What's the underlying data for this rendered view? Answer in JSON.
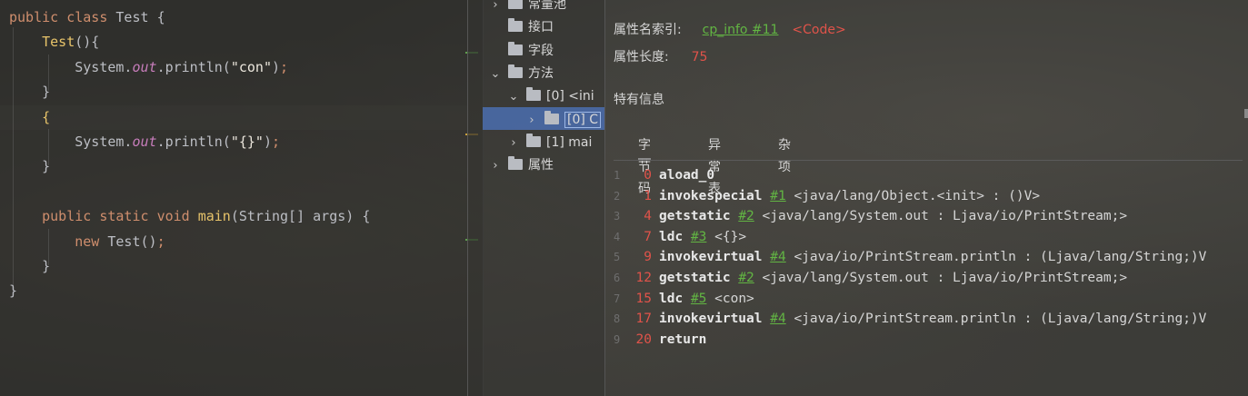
{
  "editor": {
    "lines": [
      [
        [
          "kw",
          "public "
        ],
        [
          "kw",
          "class "
        ],
        [
          "cls",
          "Test "
        ],
        [
          "punc",
          "{"
        ]
      ],
      [
        [
          "punc",
          "    "
        ],
        [
          "fn",
          "Test"
        ],
        [
          "punc",
          "(){"
        ]
      ],
      [
        [
          "punc",
          "        System."
        ],
        [
          "field",
          "out"
        ],
        [
          "punc",
          ".println("
        ],
        [
          "str",
          "\"con\""
        ],
        [
          "punc",
          ")"
        ],
        [
          "semi",
          ";"
        ]
      ],
      [
        [
          "punc",
          "    }"
        ]
      ],
      [
        [
          "fn",
          "    {"
        ]
      ],
      [
        [
          "punc",
          "        System."
        ],
        [
          "field",
          "out"
        ],
        [
          "punc",
          ".println("
        ],
        [
          "str",
          "\"{}\""
        ],
        [
          "punc",
          ")"
        ],
        [
          "semi",
          ";"
        ]
      ],
      [
        [
          "punc",
          "    }"
        ]
      ],
      [
        [
          "punc",
          ""
        ]
      ],
      [
        [
          "kw",
          "    public "
        ],
        [
          "kw",
          "static "
        ],
        [
          "kw",
          "void "
        ],
        [
          "fn",
          "main"
        ],
        [
          "punc",
          "(String[] args) {"
        ]
      ],
      [
        [
          "kw",
          "        new "
        ],
        [
          "punc",
          "Test()"
        ],
        [
          "semi",
          ";"
        ]
      ],
      [
        [
          "punc",
          "    }"
        ]
      ],
      [
        [
          "punc",
          "}"
        ]
      ]
    ]
  },
  "tree": {
    "items": [
      {
        "label": "常量池",
        "chev": "›",
        "indent": 0
      },
      {
        "label": "接口",
        "chev": "",
        "indent": 0
      },
      {
        "label": "字段",
        "chev": "",
        "indent": 0
      },
      {
        "label": "方法",
        "chev": "⌄",
        "indent": 0
      },
      {
        "label": "[0] <ini",
        "chev": "⌄",
        "indent": 1
      },
      {
        "label": "[0] C",
        "chev": "›",
        "indent": 2
      },
      {
        "label": "[1] mai",
        "chev": "›",
        "indent": 1
      },
      {
        "label": "属性",
        "chev": "›",
        "indent": 0
      }
    ]
  },
  "detail": {
    "name_index_label": "属性名索引:",
    "name_index_link": "cp_info #11",
    "name_index_value": "<Code>",
    "length_label": "属性长度:",
    "length_value": "75",
    "specific_info_label": "特有信息",
    "tabs": [
      "字节码",
      "异常表",
      "杂项"
    ],
    "bytecode": [
      {
        "n": "1",
        "off": "0",
        "op": "aload_0",
        "ref": "",
        "arg": ""
      },
      {
        "n": "2",
        "off": "1",
        "op": "invokespecial",
        "ref": "#1",
        "arg": "<java/lang/Object.<init> : ()V>"
      },
      {
        "n": "3",
        "off": "4",
        "op": "getstatic",
        "ref": "#2",
        "arg": "<java/lang/System.out : Ljava/io/PrintStream;>"
      },
      {
        "n": "4",
        "off": "7",
        "op": "ldc",
        "ref": "#3",
        "arg": "<{}>"
      },
      {
        "n": "5",
        "off": "9",
        "op": "invokevirtual",
        "ref": "#4",
        "arg": "<java/io/PrintStream.println : (Ljava/lang/String;)V"
      },
      {
        "n": "6",
        "off": "12",
        "op": "getstatic",
        "ref": "#2",
        "arg": "<java/lang/System.out : Ljava/io/PrintStream;>"
      },
      {
        "n": "7",
        "off": "15",
        "op": "ldc",
        "ref": "#5",
        "arg": "<con>"
      },
      {
        "n": "8",
        "off": "17",
        "op": "invokevirtual",
        "ref": "#4",
        "arg": "<java/io/PrintStream.println : (Ljava/lang/String;)V"
      },
      {
        "n": "9",
        "off": "20",
        "op": "return",
        "ref": "",
        "arg": ""
      }
    ]
  }
}
